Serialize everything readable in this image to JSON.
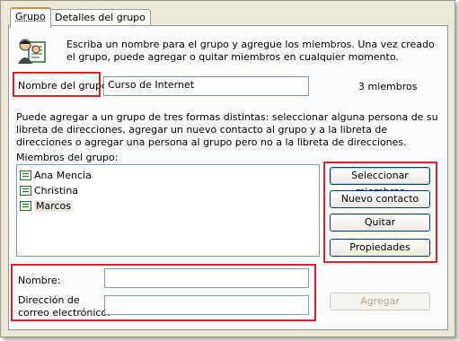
{
  "tabs": [
    {
      "label": "Grupo"
    },
    {
      "label": "Detalles del grupo"
    }
  ],
  "intro_text": "Escriba un nombre para el grupo y agregue los miembros. Una vez creado el grupo, puede agregar o quitar miembros  en cualquier momento.",
  "group_name": {
    "label": "Nombre del grupo:",
    "value": "Curso de Internet"
  },
  "member_count": "3 miembros",
  "methods_text": "Puede agregar a un grupo de tres formas distintas: seleccionar alguna persona de su libreta de direcciones, agregar un nuevo contacto al grupo y a la libreta de direcciones o agregar una persona al grupo pero no a la libreta de direcciones.",
  "members": {
    "label": "Miembros del grupo:",
    "items": [
      {
        "name": "Ana Mencia"
      },
      {
        "name": "Christina"
      },
      {
        "name": "Marcos"
      }
    ]
  },
  "buttons": {
    "select_members": "Seleccionar miembros",
    "new_contact": "Nuevo contacto",
    "remove": "Quitar",
    "properties": "Propiedades",
    "add": "Agregar"
  },
  "form": {
    "name_label": "Nombre:",
    "name_value": "",
    "email_label_line1": "Dirección de",
    "email_label_line2": "correo electrónico:",
    "email_value": ""
  },
  "accent_colors": {
    "highlight_box": "#d8232a",
    "active_tab": "#e68b2c"
  }
}
